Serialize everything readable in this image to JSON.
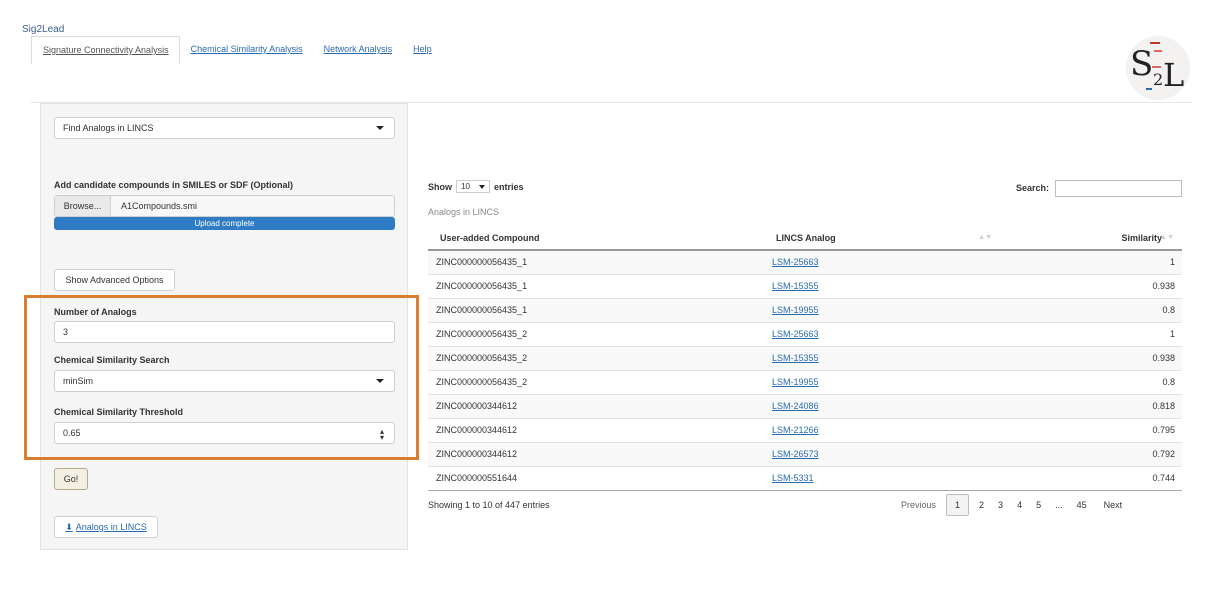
{
  "app": {
    "title": "Sig2Lead"
  },
  "tabs": [
    {
      "label": "Signature Connectivity Analysis"
    },
    {
      "label": "Chemical Similarity Analysis"
    },
    {
      "label": "Network Analysis"
    },
    {
      "label": "Help"
    }
  ],
  "logo": {
    "s": "S",
    "two": "2",
    "l": "L"
  },
  "sidebar": {
    "mode_select": "Find Analogs in LINCS",
    "upload_label": "Add candidate compounds in SMILES or SDF (Optional)",
    "browse_label": "Browse...",
    "file_name": "A1Compounds.smi",
    "upload_status": "Upload complete",
    "upload_progress": 1.0,
    "advanced_button": "Show Advanced Options",
    "num_analogs_label": "Number of Analogs",
    "num_analogs_value": "3",
    "similarity_search_label": "Chemical Similarity Search",
    "similarity_search_value": "minSim",
    "threshold_label": "Chemical Similarity Threshold",
    "threshold_value": "0.65",
    "go_button": "Go!",
    "download_button": "Analogs in LINCS"
  },
  "table": {
    "show_label": "Show",
    "entries_label": "entries",
    "length_value": "10",
    "search_label": "Search:",
    "caption": "Analogs in LINCS",
    "columns": [
      "User-added Compound",
      "LINCS Analog",
      "Similarity"
    ],
    "rows": [
      [
        "ZINC000000056435_1",
        "LSM-25663",
        "1"
      ],
      [
        "ZINC000000056435_1",
        "LSM-15355",
        "0.938"
      ],
      [
        "ZINC000000056435_1",
        "LSM-19955",
        "0.8"
      ],
      [
        "ZINC000000056435_2",
        "LSM-25663",
        "1"
      ],
      [
        "ZINC000000056435_2",
        "LSM-15355",
        "0.938"
      ],
      [
        "ZINC000000056435_2",
        "LSM-19955",
        "0.8"
      ],
      [
        "ZINC000000344612",
        "LSM-24086",
        "0.818"
      ],
      [
        "ZINC000000344612",
        "LSM-21266",
        "0.795"
      ],
      [
        "ZINC000000344612",
        "LSM-26573",
        "0.792"
      ],
      [
        "ZINC000000551644",
        "LSM-5331",
        "0.744"
      ]
    ],
    "info": "Showing 1 to 10 of 447 entries",
    "pagination": {
      "previous": "Previous",
      "pages": [
        "1",
        "2",
        "3",
        "4",
        "5",
        "...",
        "45"
      ],
      "current": "1",
      "next": "Next"
    }
  },
  "colors": {
    "link": "#2a6bb0",
    "progress": "#2f7cc4",
    "highlight_box": "#d97d2e"
  }
}
